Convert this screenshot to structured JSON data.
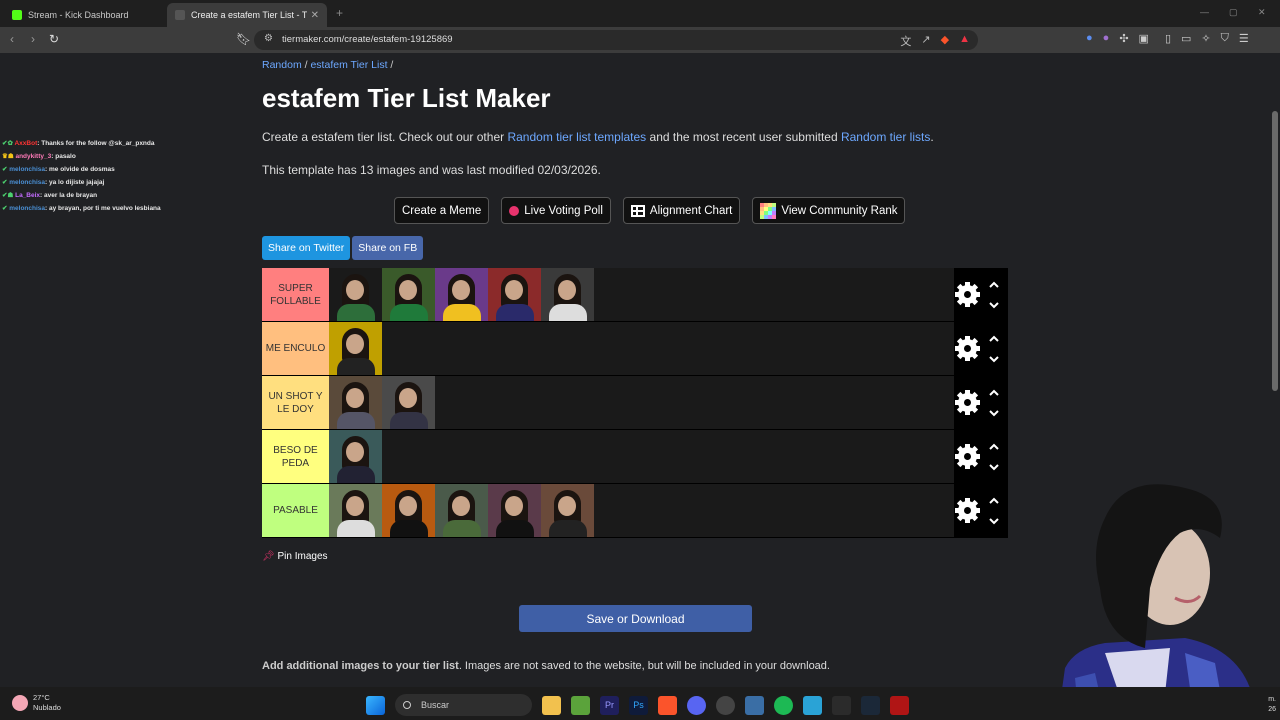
{
  "browser": {
    "tabs": [
      {
        "title": "Stream - Kick Dashboard",
        "favicon_color": "#53fc18"
      },
      {
        "title": "Create a estafem Tier List - TierMaker",
        "favicon_color": "#3a3a3a"
      }
    ],
    "url": "tiermaker.com/create/estafem-19125869"
  },
  "chat": [
    {
      "user": "AxxBot",
      "message": "Thanks for the follow @sk_ar_pxnda",
      "color": "#ff3333"
    },
    {
      "user": "andykitty_3",
      "message": "pasalo",
      "color": "#ff7ab8"
    },
    {
      "user": "melonchisa",
      "message": "me olvide de dosmas",
      "color": "#4a8fd4"
    },
    {
      "user": "melonchisa",
      "message": "ya lo dijiste jajajaj",
      "color": "#4a8fd4"
    },
    {
      "user": "La_Beix",
      "message": "aver la de brayan",
      "color": "#c46cff"
    },
    {
      "user": "melonchisa",
      "message": "ay brayan, por ti me vuelvo lesbiana",
      "color": "#4a8fd4"
    }
  ],
  "breadcrumb": {
    "random": "Random",
    "sep1": "/",
    "list": "estafem Tier List",
    "sep2": "/"
  },
  "title": "estafem Tier List Maker",
  "intro": {
    "text1": "Create a estafem tier list. Check out our other ",
    "link1": "Random tier list templates",
    "text2": " and the most recent user submitted ",
    "link2": "Random tier lists",
    "text3": "."
  },
  "meta_text": "This template has 13 images and was last modified 02/03/2026.",
  "buttons": {
    "meme": "Create a Meme",
    "poll": "Live Voting Poll",
    "alignment": "Alignment Chart",
    "community": "View Community Rank"
  },
  "share": {
    "twitter": "Share on Twitter",
    "fb": "Share on FB",
    "twitter_color": "#1da1f2",
    "fb_color": "#3b5998"
  },
  "tiers": [
    {
      "label": "SUPER FOLLABLE",
      "color": "#ff7f7f",
      "count": 5
    },
    {
      "label": "ME ENCULO",
      "color": "#ffbf7f",
      "count": 1
    },
    {
      "label": "UN SHOT Y LE DOY",
      "color": "#ffdf7f",
      "count": 2
    },
    {
      "label": "BESO DE PEDA",
      "color": "#ffff7f",
      "count": 1
    },
    {
      "label": "PASABLE",
      "color": "#bfff7f",
      "count": 5
    }
  ],
  "pin_label": "Pin Images",
  "save_label": "Save or Download",
  "add_images": {
    "bold": "Add additional images to your tier list",
    "rest": ". Images are not saved to the website, but will be included in your download."
  },
  "taskbar": {
    "temp": "27°C",
    "weather": "Nublado",
    "search": "Buscar",
    "time": "m.",
    "date": "26"
  }
}
